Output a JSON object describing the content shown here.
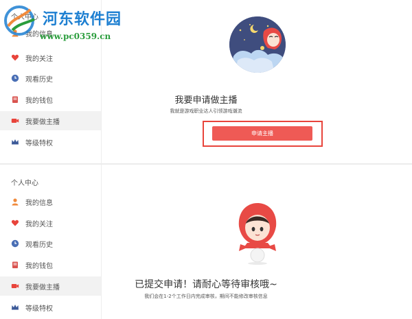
{
  "watermark": {
    "site_name": "河东软件园",
    "url": "www.pc0359.cn"
  },
  "colors": {
    "accent": "#ef5a55",
    "highlight_border": "#e8443b",
    "avatar_bg": "#3f4d7e"
  },
  "top_panel": {
    "sidebar": {
      "title": "个人中心",
      "items": [
        {
          "label": "我的信息",
          "icon": "user-icon"
        },
        {
          "label": "我的关注",
          "icon": "heart-icon"
        },
        {
          "label": "观看历史",
          "icon": "clock-icon"
        },
        {
          "label": "我的钱包",
          "icon": "wallet-icon"
        },
        {
          "label": "我要做主播",
          "icon": "camera-icon",
          "active": true
        },
        {
          "label": "等级特权",
          "icon": "crown-icon"
        }
      ]
    },
    "main": {
      "title": "我要申请做主播",
      "subtitle": "我就是游戏职业达人引领游戏潮流",
      "apply_button": "申请主播"
    }
  },
  "bottom_panel": {
    "sidebar": {
      "title": "个人中心",
      "items": [
        {
          "label": "我的信息",
          "icon": "user-icon"
        },
        {
          "label": "我的关注",
          "icon": "heart-icon"
        },
        {
          "label": "观看历史",
          "icon": "clock-icon"
        },
        {
          "label": "我的钱包",
          "icon": "wallet-icon"
        },
        {
          "label": "我要做主播",
          "icon": "camera-icon",
          "active": true
        },
        {
          "label": "等级特权",
          "icon": "crown-icon"
        }
      ]
    },
    "main": {
      "title": "已提交申请！请耐心等待审核哦~",
      "subtitle": "我们会在1-2个工作日内完成审核，期间不能修改审核信息"
    }
  }
}
